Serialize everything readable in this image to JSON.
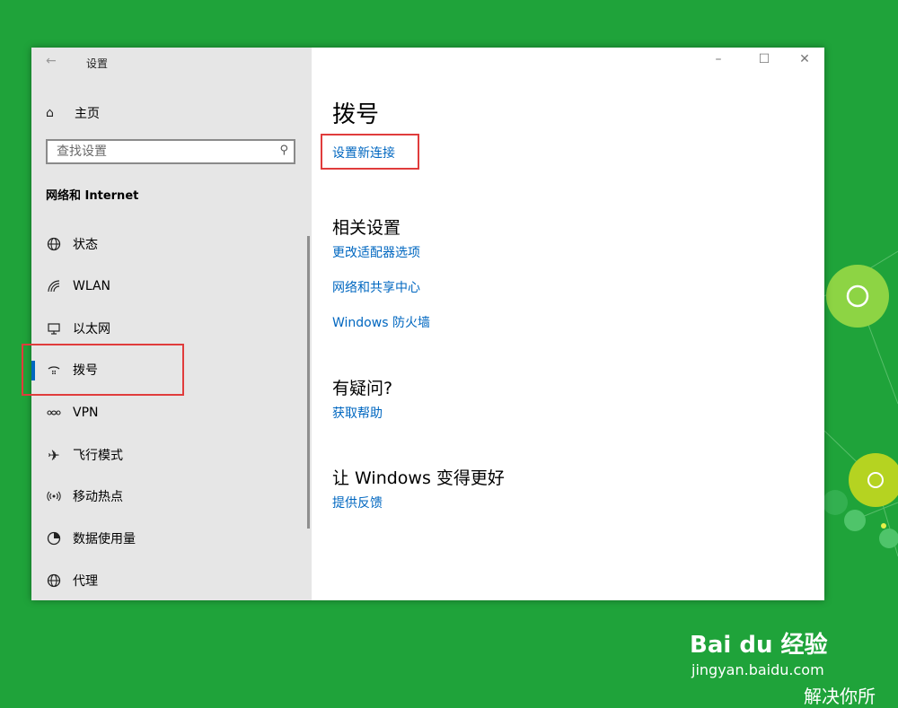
{
  "window": {
    "title": "设置",
    "controls": {
      "minimize": "–",
      "maximize": "☐",
      "close": "✕"
    }
  },
  "sidebar": {
    "home_label": "主页",
    "search": {
      "placeholder": "查找设置"
    },
    "section_title": "网络和 Internet",
    "items": [
      {
        "label": "状态",
        "icon": "globe-status-icon"
      },
      {
        "label": "WLAN",
        "icon": "wifi-icon"
      },
      {
        "label": "以太网",
        "icon": "ethernet-icon"
      },
      {
        "label": "拨号",
        "icon": "dialup-icon",
        "selected": true
      },
      {
        "label": "VPN",
        "icon": "vpn-icon"
      },
      {
        "label": "飞行模式",
        "icon": "airplane-icon"
      },
      {
        "label": "移动热点",
        "icon": "hotspot-icon"
      },
      {
        "label": "数据使用量",
        "icon": "data-usage-icon"
      },
      {
        "label": "代理",
        "icon": "proxy-globe-icon"
      }
    ]
  },
  "content": {
    "heading": "拨号",
    "setup_link": "设置新连接",
    "related": {
      "title": "相关设置",
      "links": [
        "更改适配器选项",
        "网络和共享中心",
        "Windows 防火墙"
      ]
    },
    "question": {
      "title": "有疑问?",
      "link": "获取帮助"
    },
    "improve": {
      "title": "让 Windows 变得更好",
      "link": "提供反馈"
    }
  },
  "watermark": {
    "brand": "Bai du 经验",
    "url": "jingyan.baidu.com",
    "tagline": "解决你所"
  },
  "colors": {
    "accent": "#0067c0",
    "highlight": "#e03c3c",
    "background": "#1fa33a",
    "sidebar": "#e6e6e6"
  }
}
